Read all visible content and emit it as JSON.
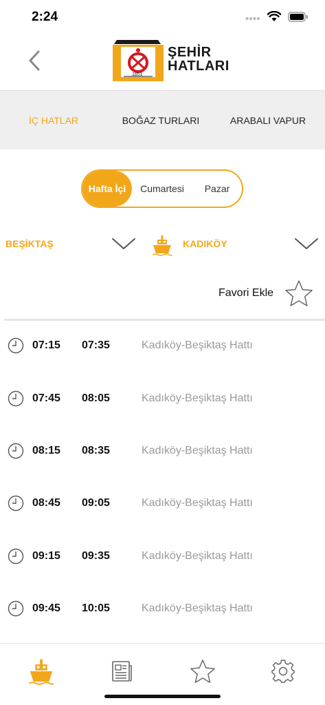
{
  "status_bar": {
    "time": "2:24"
  },
  "header": {
    "logo_line1": "ŞEHİR",
    "logo_line2": "HATLARI",
    "logo_year": "1851"
  },
  "tabs": [
    {
      "label": "İÇ HATLAR",
      "active": true
    },
    {
      "label": "BOĞAZ TURLARI",
      "active": false
    },
    {
      "label": "ARABALI VAPUR",
      "active": false
    }
  ],
  "day_filter": {
    "options": [
      "Hafta İçi",
      "Cumartesi",
      "Pazar"
    ],
    "selected": "Hafta İçi"
  },
  "route": {
    "from": "BEŞİKTAŞ",
    "to": "KADIKÖY"
  },
  "favorite": {
    "label": "Favori Ekle"
  },
  "schedule": [
    {
      "departure": "07:15",
      "arrival": "07:35",
      "line": "Kadıköy-Beşiktaş Hattı"
    },
    {
      "departure": "07:45",
      "arrival": "08:05",
      "line": "Kadıköy-Beşiktaş Hattı"
    },
    {
      "departure": "08:15",
      "arrival": "08:35",
      "line": "Kadıköy-Beşiktaş Hattı"
    },
    {
      "departure": "08:45",
      "arrival": "09:05",
      "line": "Kadıköy-Beşiktaş Hattı"
    },
    {
      "departure": "09:15",
      "arrival": "09:35",
      "line": "Kadıköy-Beşiktaş Hattı"
    },
    {
      "departure": "09:45",
      "arrival": "10:05",
      "line": "Kadıköy-Beşiktaş Hattı"
    }
  ],
  "tab_bar": [
    {
      "icon": "ferry-icon",
      "active": true
    },
    {
      "icon": "newspaper-icon",
      "active": false
    },
    {
      "icon": "star-icon",
      "active": false
    },
    {
      "icon": "gear-icon",
      "active": false
    }
  ],
  "colors": {
    "accent": "#f2a71b",
    "logo_red": "#d71920",
    "muted_text": "#9a9a9a",
    "tab_strip_bg": "#efefef"
  }
}
